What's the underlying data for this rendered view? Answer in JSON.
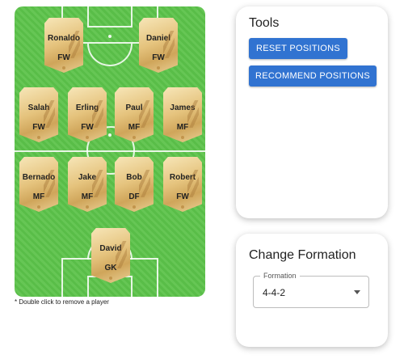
{
  "pitch": {
    "players": [
      {
        "name": "Ronaldo",
        "position": "FW"
      },
      {
        "name": "Daniel",
        "position": "FW"
      },
      {
        "name": "Salah",
        "position": "FW"
      },
      {
        "name": "Erling",
        "position": "FW"
      },
      {
        "name": "Paul",
        "position": "MF"
      },
      {
        "name": "James",
        "position": "MF"
      },
      {
        "name": "Bernado",
        "position": "MF"
      },
      {
        "name": "Jake",
        "position": "MF"
      },
      {
        "name": "Bob",
        "position": "DF"
      },
      {
        "name": "Robert",
        "position": "FW"
      },
      {
        "name": "David",
        "position": "GK"
      }
    ],
    "note": "* Double click to remove a player"
  },
  "tools": {
    "title": "Tools",
    "reset_label": "RESET POSITIONS",
    "recommend_label": "RECOMMEND POSITIONS"
  },
  "formation": {
    "title": "Change Formation",
    "select_label": "Formation",
    "selected": "4-4-2"
  },
  "colors": {
    "button": "#3173d1",
    "pitch": "#5cc34a"
  }
}
